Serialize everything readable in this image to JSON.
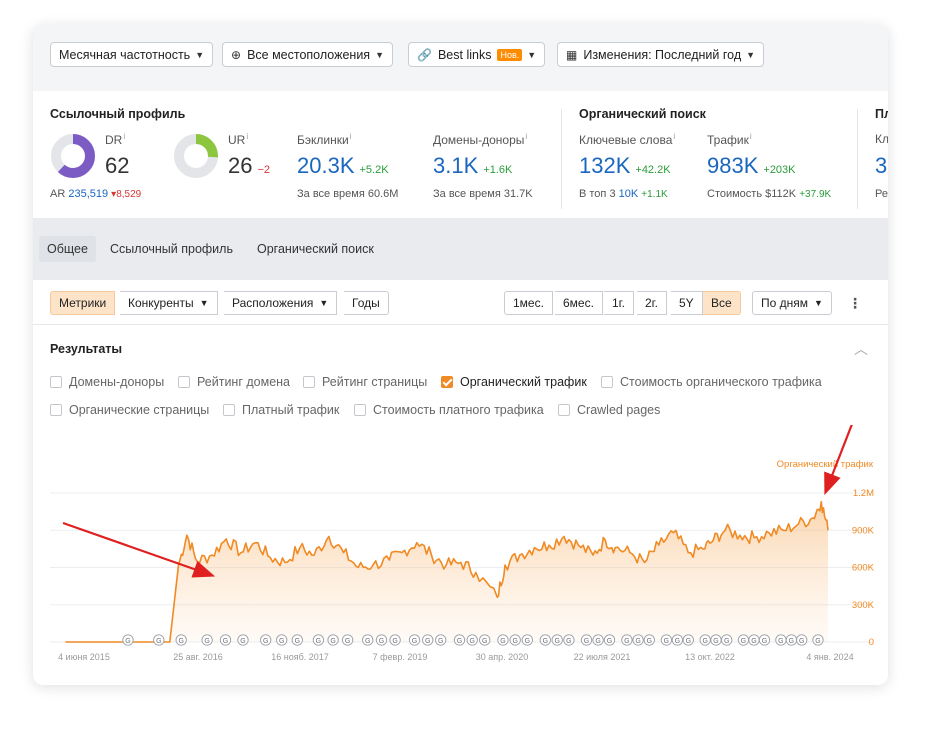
{
  "filters": {
    "frequency": "Месячная частотность",
    "locations": "Все местоположения",
    "best_links": "Best links",
    "new_badge": "Нов.",
    "changes": "Изменения: Последний год"
  },
  "sections": {
    "link_profile": "Ссылочный профиль",
    "organic": "Органический поиск",
    "cut": "Пл"
  },
  "metrics": {
    "dr": {
      "label": "DR",
      "value": "62",
      "fill": 0.62
    },
    "ar": {
      "label": "AR",
      "value": "235,519",
      "delta": "▾8,529"
    },
    "ur": {
      "label": "UR",
      "value": "26",
      "delta": "−2",
      "fill": 0.26
    },
    "backlinks": {
      "label": "Бэклинки",
      "value": "20.3K",
      "delta": "+5.2K",
      "sub_label": "За все время",
      "sub_value": "60.6M"
    },
    "ref_domains": {
      "label": "Домены-доноры",
      "value": "3.1K",
      "delta": "+1.6K",
      "sub_label": "За все время",
      "sub_value": "31.7K"
    },
    "keywords": {
      "label": "Ключевые слова",
      "value": "132K",
      "delta": "+42.2K",
      "sub_label": "В топ 3",
      "sub_value": "10K",
      "sub_delta": "+1.1K"
    },
    "traffic": {
      "label": "Трафик",
      "value": "983K",
      "delta": "+203K",
      "sub_label": "Стоимость",
      "sub_value": "$112K",
      "sub_delta": "+37.9K"
    },
    "cut_label": "Кл",
    "cut_value": "3",
    "cut_sub": "Ре",
    "info_mark": "i"
  },
  "tabs": [
    "Общее",
    "Ссылочный профиль",
    "Органический поиск"
  ],
  "toolbar": {
    "metrics": "Метрики",
    "competitors": "Конкуренты",
    "locations": "Расположения",
    "years": "Годы",
    "ranges": [
      "1мес.",
      "6мес.",
      "1г.",
      "2г.",
      "5Y",
      "Все"
    ],
    "granularity": "По дням"
  },
  "results": {
    "title": "Результаты",
    "checkboxes": [
      {
        "label": "Домены-доноры",
        "checked": false
      },
      {
        "label": "Рейтинг домена",
        "checked": false
      },
      {
        "label": "Рейтинг страницы",
        "checked": false
      },
      {
        "label": "Органический трафик",
        "checked": true
      },
      {
        "label": "Стоимость органического трафика",
        "checked": false
      },
      {
        "label": "Органические страницы",
        "checked": false
      },
      {
        "label": "Платный трафик",
        "checked": false
      },
      {
        "label": "Стоимость платного трафика",
        "checked": false
      },
      {
        "label": "Crawled pages",
        "checked": false
      }
    ]
  },
  "colors": {
    "accent": "#f08a24",
    "link": "#1a66c0",
    "green": "#2a9d3a",
    "red": "#d93434",
    "dr_ring": "#7c5cc4",
    "ur_ring": "#8cc63f"
  },
  "chart_data": {
    "type": "area",
    "series": [
      {
        "name": "Органический трафик",
        "x": [
          "2015-06-04",
          "2016-03-01",
          "2016-08-10",
          "2016-09-15",
          "2016-10-20",
          "2016-12-01",
          "2017-02-01",
          "2017-04-01",
          "2017-06-01",
          "2017-08-01",
          "2017-10-01",
          "2017-12-01",
          "2018-02-01",
          "2018-04-01",
          "2018-06-01",
          "2018-08-01",
          "2018-10-01",
          "2018-12-01",
          "2019-02-07",
          "2019-04-01",
          "2019-06-01",
          "2019-08-01",
          "2019-10-01",
          "2019-12-01",
          "2020-02-01",
          "2020-04-30",
          "2020-06-01",
          "2020-08-01",
          "2020-10-01",
          "2020-12-01",
          "2021-02-01",
          "2021-04-01",
          "2021-06-01",
          "2021-07-22",
          "2021-09-01",
          "2021-11-01",
          "2022-01-01",
          "2022-03-01",
          "2022-05-01",
          "2022-07-01",
          "2022-09-01",
          "2022-10-13",
          "2022-12-01",
          "2023-02-01",
          "2023-04-01",
          "2023-06-01",
          "2023-08-01",
          "2023-10-01",
          "2023-12-01",
          "2024-01-04",
          "2024-02-01"
        ],
        "values": [
          0,
          0,
          0,
          620000,
          860000,
          650000,
          700000,
          830000,
          720000,
          800000,
          680000,
          640000,
          760000,
          700000,
          850000,
          720000,
          600000,
          620000,
          660000,
          720000,
          800000,
          700000,
          620000,
          640000,
          560000,
          360000,
          620000,
          700000,
          760000,
          780000,
          850000,
          780000,
          700000,
          820000,
          760000,
          720000,
          640000,
          780000,
          880000,
          720000,
          750000,
          820000,
          900000,
          860000,
          840000,
          880000,
          900000,
          950000,
          1000000,
          1130000,
          900000
        ]
      }
    ],
    "x_ticks": [
      "4 июня 2015",
      "25 авг. 2016",
      "16 нояб. 2017",
      "7 февр. 2019",
      "30 апр. 2020",
      "22 июля 2021",
      "13 окт. 2022",
      "4 янв. 2024"
    ],
    "y_ticks": [
      "0",
      "300K",
      "600K",
      "900K",
      "1.2M"
    ],
    "ylim": [
      0,
      1200000
    ],
    "legend": "Органический трафик",
    "legend_position": "top-right",
    "grid": true,
    "update_markers": "G",
    "marker_count": 46
  }
}
